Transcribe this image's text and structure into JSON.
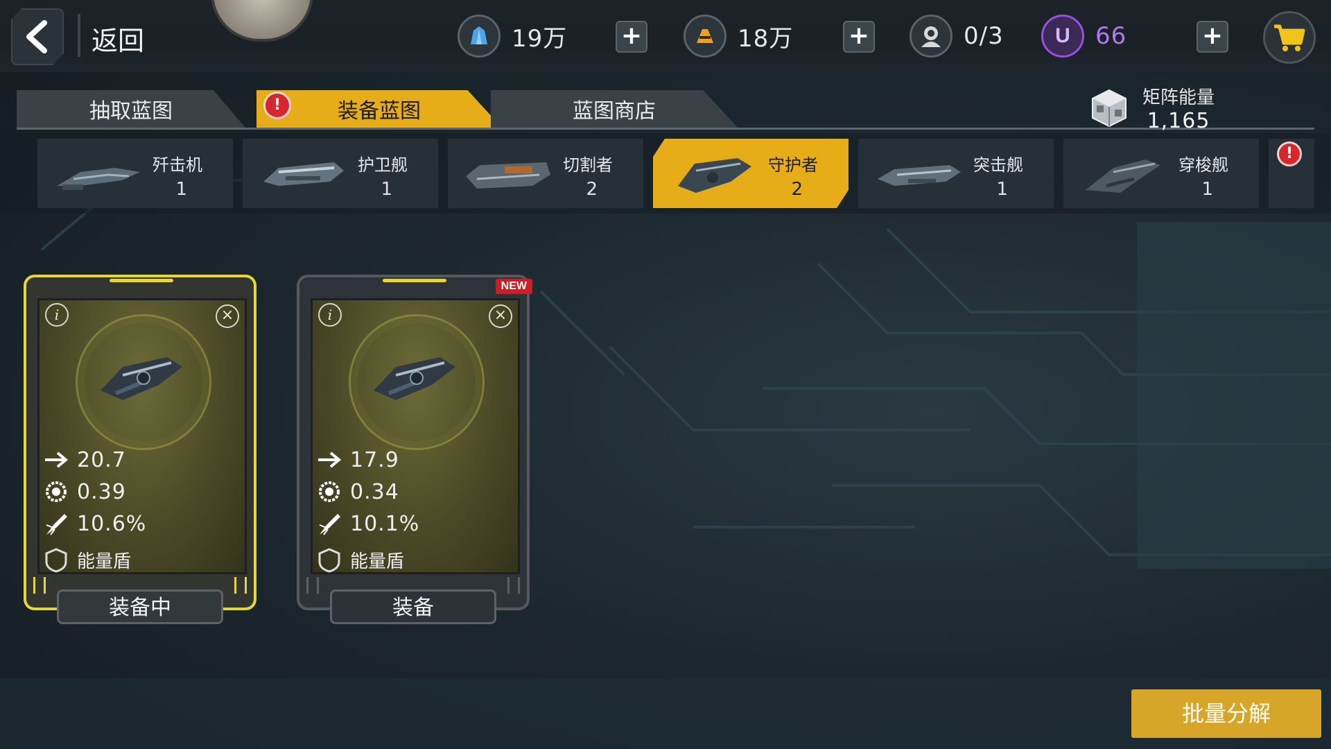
{
  "header": {
    "back_label": "返回",
    "resources": [
      {
        "icon": "crystal-icon",
        "value": "19万",
        "color": "#4aa6e8"
      },
      {
        "icon": "gold-icon",
        "value": "18万",
        "color": "#f0a21a"
      },
      {
        "icon": "pilot-icon",
        "value": "0/3",
        "color": "#d8d8d8"
      },
      {
        "icon": "u-coin-icon",
        "value": "66",
        "color": "#9b4fe0"
      }
    ]
  },
  "tabs": [
    {
      "label": "抽取蓝图",
      "active": false
    },
    {
      "label": "装备蓝图",
      "active": true,
      "alert": "!"
    },
    {
      "label": "蓝图商店",
      "active": false
    }
  ],
  "matrix": {
    "label": "矩阵能量",
    "value": "1,165"
  },
  "ships": [
    {
      "label": "歼击机",
      "count": "1"
    },
    {
      "label": "护卫舰",
      "count": "1"
    },
    {
      "label": "切割者",
      "count": "2"
    },
    {
      "label": "守护者",
      "count": "2",
      "active": true
    },
    {
      "label": "突击舰",
      "count": "1"
    },
    {
      "label": "穿梭舰",
      "count": "1"
    }
  ],
  "more_alert": "!",
  "cards": [
    {
      "attack": "20.7",
      "rate": "0.39",
      "crit": "10.6%",
      "shield": "能量盾",
      "button": "装备中",
      "equipped": true
    },
    {
      "attack": "17.9",
      "rate": "0.34",
      "crit": "10.1%",
      "shield": "能量盾",
      "button": "装备",
      "badge": "NEW",
      "equipped": false
    }
  ],
  "decompose_label": "批量分解",
  "accent_color": "#e6ad19"
}
